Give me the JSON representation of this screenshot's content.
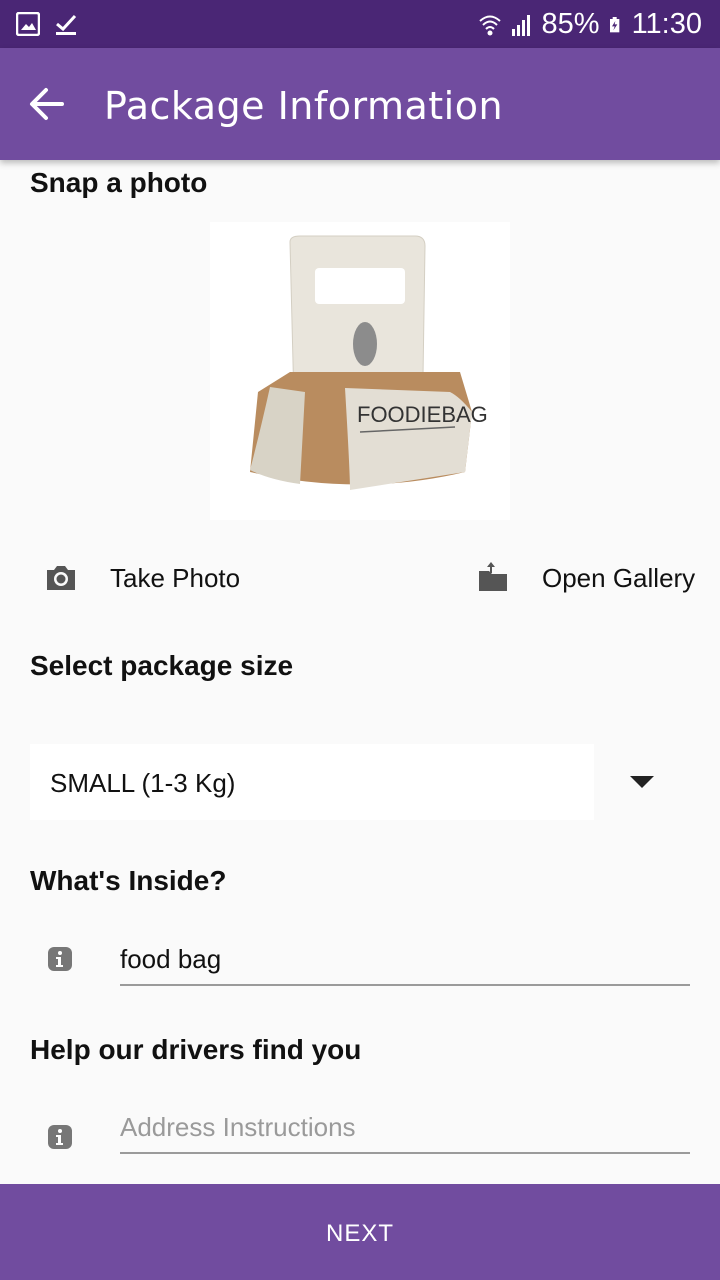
{
  "status_bar": {
    "battery": "85%",
    "time": "11:30",
    "icons": [
      "image-icon",
      "check-icon",
      "wifi-icon",
      "signal-icon",
      "battery-icon"
    ]
  },
  "app_bar": {
    "title": "Package Information",
    "back_icon": "back-arrow-icon"
  },
  "photo_section": {
    "title": "Snap a photo",
    "take_photo": "Take Photo",
    "open_gallery": "Open Gallery",
    "image_label": "FOODIEBAG"
  },
  "package_size": {
    "title": "Select package size",
    "selected": "SMALL (1-3 Kg)"
  },
  "inside": {
    "title": "What's Inside?",
    "value": "food bag"
  },
  "address": {
    "title": "Help our drivers find you",
    "placeholder": "Address Instructions"
  },
  "next_button": "NEXT",
  "colors": {
    "status_bar": "#4a2675",
    "app_bar": "#714c9f",
    "button": "#714c9f"
  }
}
